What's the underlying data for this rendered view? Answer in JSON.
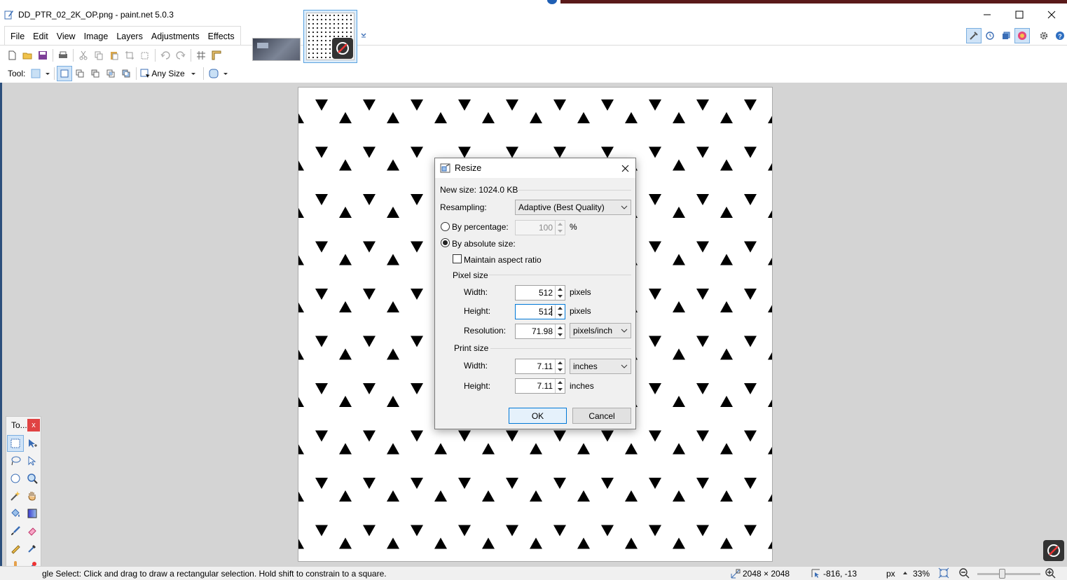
{
  "window": {
    "title": "DD_PTR_02_2K_OP.png - paint.net 5.0.3"
  },
  "menu": {
    "items": [
      "File",
      "Edit",
      "View",
      "Image",
      "Layers",
      "Adjustments",
      "Effects"
    ]
  },
  "toolbar": {
    "tool_label": "Tool:",
    "size_mode": "Any Size"
  },
  "tools_panel": {
    "title": "To...",
    "close": "x"
  },
  "dialog": {
    "title": "Resize",
    "new_size_label": "New size: 1024.0 KB",
    "resampling_label": "Resampling:",
    "resampling_value": "Adaptive (Best Quality)",
    "by_percentage_label": "By percentage:",
    "percentage_value": "100",
    "percent_symbol": "%",
    "by_absolute_label": "By absolute size:",
    "maintain_aspect_label": "Maintain aspect ratio",
    "maintain_aspect_checked": false,
    "pixel_size_group": "Pixel size",
    "width_label": "Width:",
    "width_value": "512",
    "height_label": "Height:",
    "height_value": "512",
    "pixels_unit": "pixels",
    "resolution_label": "Resolution:",
    "resolution_value": "71.98",
    "resolution_unit": "pixels/inch",
    "print_size_group": "Print size",
    "print_width_label": "Width:",
    "print_width_value": "7.11",
    "print_width_unit": "inches",
    "print_height_label": "Height:",
    "print_height_value": "7.11",
    "print_height_unit": "inches",
    "ok_label": "OK",
    "cancel_label": "Cancel",
    "selected_mode": "absolute"
  },
  "status": {
    "hint": "gle Select: Click and drag to draw a rectangular selection. Hold shift to constrain to a square.",
    "image_size": "2048 × 2048",
    "cursor_pos": "-816, -13",
    "units": "px",
    "zoom": "33%"
  },
  "colors": {
    "accent": "#0078d7",
    "selection": "#cfe3f7",
    "workspace": "#d4d4d4"
  }
}
